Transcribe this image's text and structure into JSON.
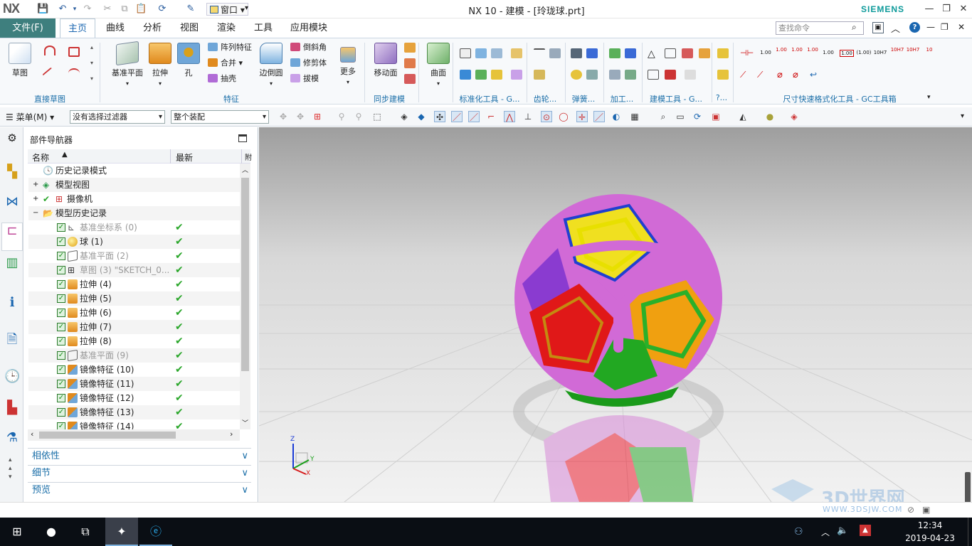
{
  "app": {
    "logo": "NX",
    "window_title": "NX 10 - 建模 - [玲珑球.prt]",
    "brand": "SIEMENS",
    "window_menu": "窗口",
    "accent_color": "#3e7f7e",
    "link_color": "#1a6ea8"
  },
  "tabs": {
    "file": "文件(F)",
    "items": [
      "主页",
      "曲线",
      "分析",
      "视图",
      "渲染",
      "工具",
      "应用模块"
    ],
    "active": "主页"
  },
  "search": {
    "placeholder": "查找命令"
  },
  "ribbon": {
    "sketch": {
      "label": "草图",
      "group": "直接草图"
    },
    "feature": {
      "datum_plane": "基准平面",
      "extrude": "拉伸",
      "hole": "孔",
      "pattern": "阵列特征",
      "unite": "合并",
      "shell": "抽壳",
      "edge_blend": "边倒圆",
      "chamfer": "倒斜角",
      "trim_body": "修剪体",
      "draft": "拔模",
      "more": "更多",
      "group": "特征"
    },
    "sync": {
      "move_face": "移动面",
      "group": "同步建模"
    },
    "surface": {
      "label": "曲面"
    },
    "groups_right": {
      "std_tools": "标准化工具 - G...",
      "gear": "齿轮...",
      "spring": "弹簧...",
      "machining": "加工...",
      "modeling_tools": "建模工具 - G...",
      "misc": "?...",
      "dim_format": "尺寸快速格式化工具 - GC工具箱"
    },
    "dim_labels": [
      "1.00",
      "1.00",
      "1.00",
      "1.00",
      "1.00",
      "(1.00)",
      "10H7",
      "10H7",
      "10H7",
      "10"
    ]
  },
  "toolbar": {
    "menu": "菜单(M)",
    "filter": "没有选择过滤器",
    "assembly": "整个装配"
  },
  "navigator": {
    "title": "部件导航器",
    "col_name": "名称",
    "col_latest": "最新",
    "col_extra": "附",
    "top_nodes": [
      "历史记录模式",
      "模型视图",
      "摄像机",
      "模型历史记录"
    ],
    "features": [
      {
        "name": "基准坐标系 (0)",
        "dim": true
      },
      {
        "name": "球 (1)",
        "dim": false
      },
      {
        "name": "基准平面 (2)",
        "dim": true
      },
      {
        "name": "草图 (3) \"SKETCH_0...",
        "dim": true
      },
      {
        "name": "拉伸 (4)",
        "dim": false
      },
      {
        "name": "拉伸 (5)",
        "dim": false
      },
      {
        "name": "拉伸 (6)",
        "dim": false
      },
      {
        "name": "拉伸 (7)",
        "dim": false
      },
      {
        "name": "拉伸 (8)",
        "dim": false
      },
      {
        "name": "基准平面 (9)",
        "dim": true
      },
      {
        "name": "镜像特征 (10)",
        "dim": false
      },
      {
        "name": "镜像特征 (11)",
        "dim": false
      },
      {
        "name": "镜像特征 (12)",
        "dim": false
      },
      {
        "name": "镜像特征 (13)",
        "dim": false
      },
      {
        "name": "镜像特征 (14)",
        "dim": false
      }
    ],
    "panels": [
      "相依性",
      "细节",
      "预览"
    ]
  },
  "viewport": {
    "triad": {
      "z": "Z",
      "y": "Y",
      "x": "X"
    }
  },
  "watermark": {
    "text": "3D世界网",
    "url": "WWW.3DSJW.COM"
  },
  "taskbar": {
    "time": "12:34",
    "date": "2019-04-23"
  }
}
